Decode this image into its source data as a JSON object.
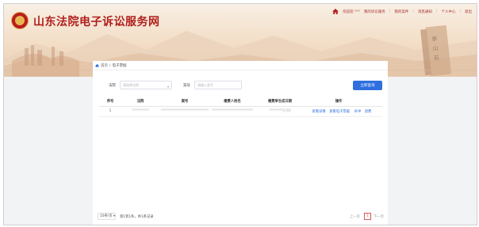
{
  "header": {
    "site_title": "山东法院电子诉讼服务网",
    "nav": {
      "user": "欢迎您 ***",
      "items": [
        "我的诉讼服务",
        "我的案件",
        "消息通知",
        "个人中心",
        "退出"
      ]
    }
  },
  "breadcrumb": {
    "home": "首页",
    "separator": "/",
    "current": "电子票据"
  },
  "search": {
    "court_label": "法院",
    "court_placeholder": "请选择法院",
    "case_no_label": "案号",
    "case_no_placeholder": "请输入案号",
    "submit_label": "立即查询"
  },
  "table": {
    "columns": [
      "序号",
      "法院",
      "案号",
      "缴费人姓名",
      "缴费单生成日期",
      "操作"
    ],
    "rows": [
      {
        "index": "1",
        "court": "**********",
        "case_no": "****************************",
        "payer": "************************",
        "date": "********2:43",
        "actions": [
          "查看详情",
          "查看电子票据",
          "补冲",
          "退费"
        ]
      }
    ]
  },
  "pagination": {
    "page_size": "10条/页",
    "info": "第1到1条，共1条记录",
    "prev": "上一页",
    "current_page": "1",
    "next": "下一页"
  },
  "colors": {
    "brand_red": "#b0201e",
    "primary_blue": "#2f6fe0",
    "active_page": "#e05555"
  }
}
